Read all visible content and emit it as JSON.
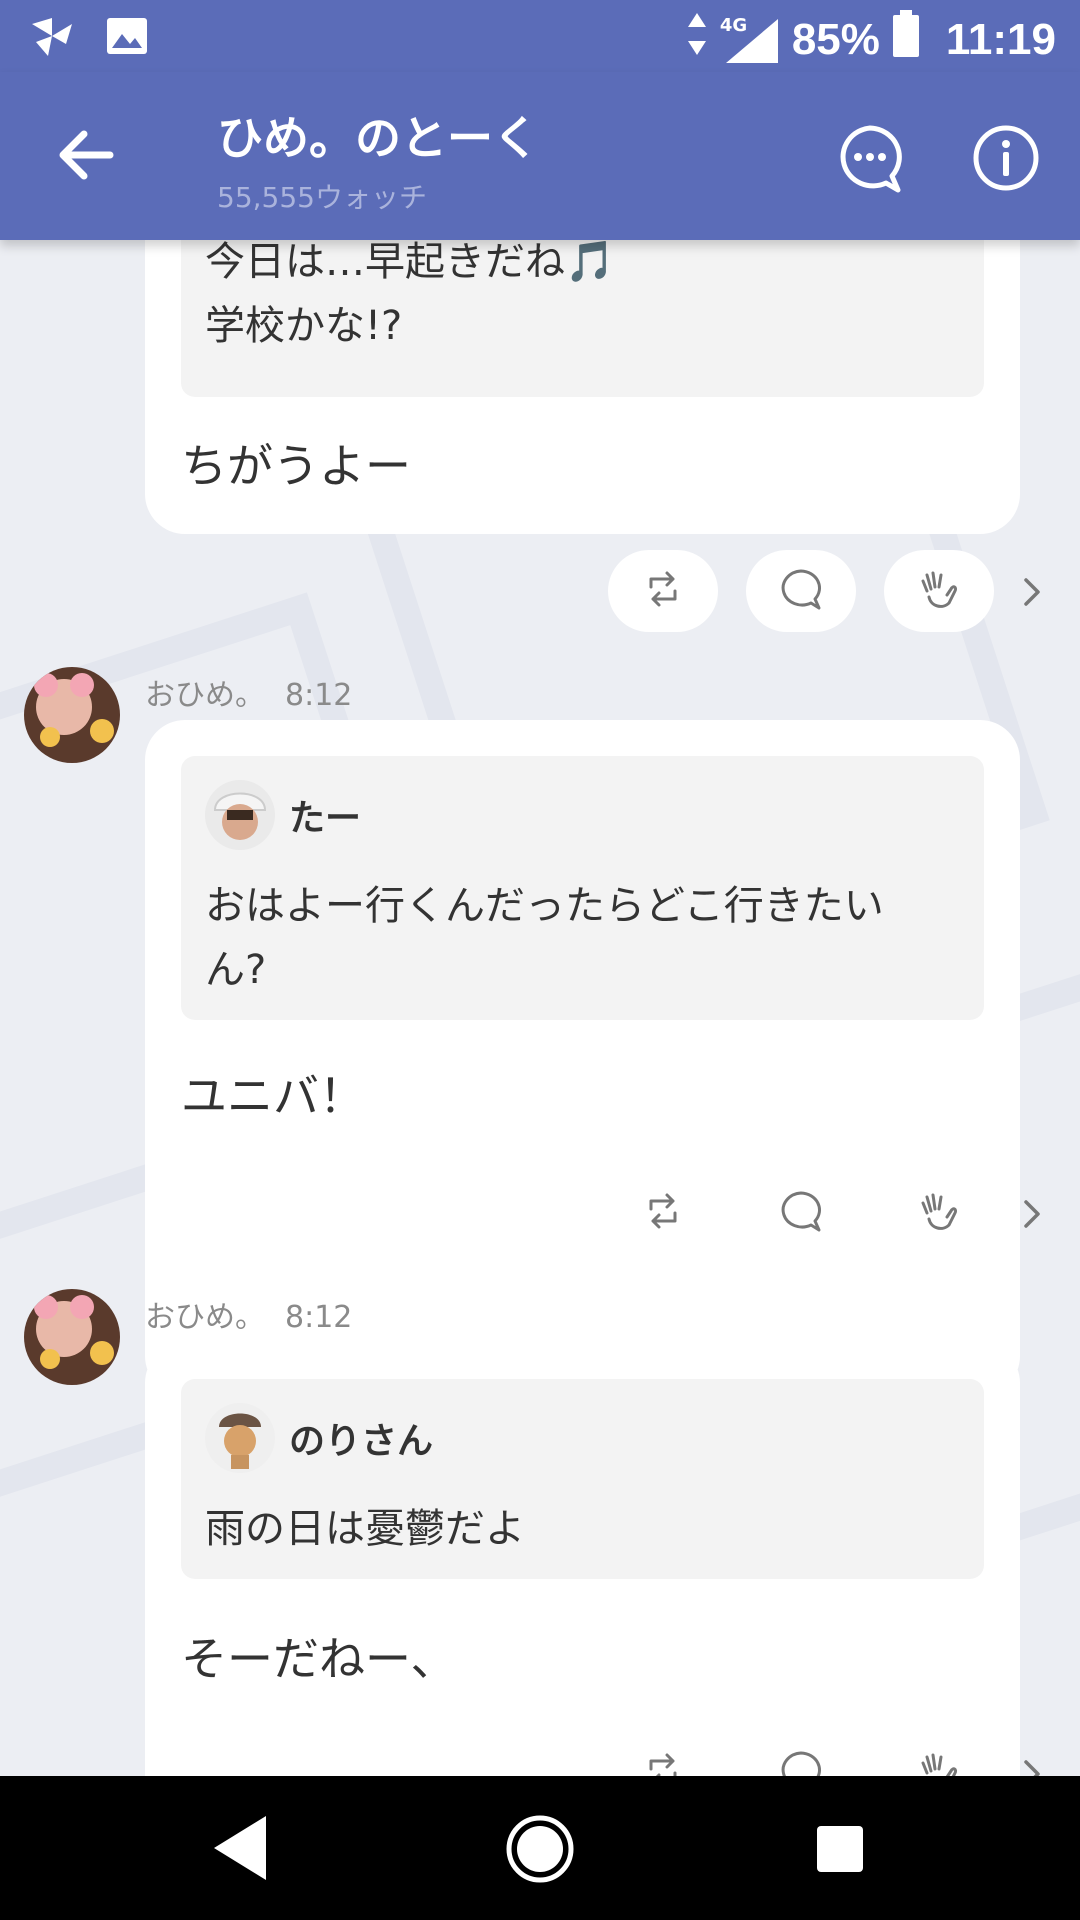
{
  "status_bar": {
    "network": "4G",
    "battery_percent": "85%",
    "time": "11:19",
    "icons": [
      "pinwheel-icon",
      "image-icon",
      "data-arrows-icon",
      "signal-icon",
      "battery-icon"
    ]
  },
  "header": {
    "title": "ひめ。のとーく",
    "subtitle": "55,555ウォッチ",
    "icons": [
      "back-arrow-icon",
      "chat-bubble-icon",
      "info-icon"
    ]
  },
  "posts": [
    {
      "quote_lines": [
        "今日は…早起きだね🎵",
        "学校かな!?"
      ],
      "reply": "ちがうよー"
    },
    {
      "author": "おひめ。",
      "time": "8:12",
      "quote_author": "たー",
      "quote_lines": [
        "おはよー行くんだったらどこ行きたい",
        "ん?"
      ],
      "reply": "ユニバ！"
    },
    {
      "author": "おひめ。",
      "time": "8:12",
      "quote_author": "のりさん",
      "quote_lines": [
        "雨の日は憂鬱だよ"
      ],
      "reply": "そーだねー、"
    }
  ],
  "action_icons": [
    "repost-icon",
    "comment-icon",
    "clap-icon",
    "chevron-right-icon"
  ],
  "colors": {
    "header_bg": "#5b6cb8",
    "feed_bg": "#eceef3",
    "bubble_bg": "#ffffff",
    "quote_bg": "#f3f3f3"
  }
}
